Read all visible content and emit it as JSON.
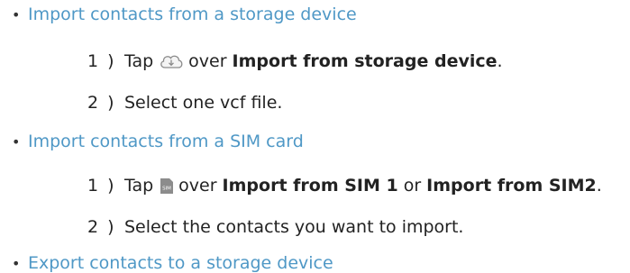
{
  "sections": [
    {
      "bullet": "•",
      "title": "Import contacts from a storage device",
      "steps": [
        {
          "num": "1 )",
          "pre": "Tap",
          "icon": "cloud-download-icon",
          "mid": "over",
          "bold1": "Import from storage device",
          "join": "",
          "bold2": "",
          "end": "."
        },
        {
          "num": "2 )",
          "text": "Select one vcf file."
        }
      ]
    },
    {
      "bullet": "•",
      "title": "Import contacts from a SIM card",
      "steps": [
        {
          "num": "1 )",
          "pre": "Tap",
          "icon": "sim-card-icon",
          "icon_text": "SIM",
          "mid": "over",
          "bold1": "Import from SIM 1",
          "join": "or",
          "bold2": "Import from SIM2",
          "end": "."
        },
        {
          "num": "2 )",
          "text": "Select the contacts you want to import."
        }
      ]
    },
    {
      "bullet": "•",
      "title": "Export contacts to a storage device"
    }
  ],
  "colors": {
    "accent": "#4f98c6",
    "text": "#222222"
  }
}
